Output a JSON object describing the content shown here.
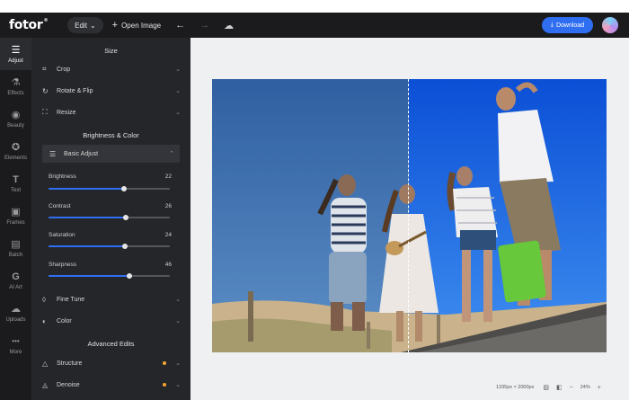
{
  "topbar": {
    "logo": "fotor",
    "logo_mark": "®",
    "edit_label": "Edit",
    "open_image_label": "Open Image",
    "download_label": "Download"
  },
  "rail": {
    "items": [
      {
        "label": "Adjust",
        "icon": "sliders-icon",
        "glyph": "☰"
      },
      {
        "label": "Effects",
        "icon": "flask-icon",
        "glyph": "⚗"
      },
      {
        "label": "Beauty",
        "icon": "eye-icon",
        "glyph": "◉"
      },
      {
        "label": "Elements",
        "icon": "star-icon",
        "glyph": "✪"
      },
      {
        "label": "Text",
        "icon": "text-icon",
        "glyph": "T"
      },
      {
        "label": "Frames",
        "icon": "frame-icon",
        "glyph": "▣"
      },
      {
        "label": "Batch",
        "icon": "image-stack-icon",
        "glyph": "▤"
      },
      {
        "label": "AI Art",
        "icon": "ai-art-icon",
        "glyph": "G"
      },
      {
        "label": "Uploads",
        "icon": "cloud-upload-icon",
        "glyph": "☁"
      },
      {
        "label": "More",
        "icon": "more-icon",
        "glyph": "•••"
      }
    ]
  },
  "panel": {
    "size_title": "Size",
    "crop_label": "Crop",
    "rotate_label": "Rotate & Flip",
    "resize_label": "Resize",
    "brightness_title": "Brightness & Color",
    "basic_adjust_label": "Basic Adjust",
    "sliders": [
      {
        "label": "Brightness",
        "value": 22,
        "fraction": 0.62
      },
      {
        "label": "Contrast",
        "value": 26,
        "fraction": 0.64
      },
      {
        "label": "Saturation",
        "value": 24,
        "fraction": 0.63
      },
      {
        "label": "Sharpness",
        "value": 46,
        "fraction": 0.67
      }
    ],
    "fine_tune_label": "Fine Tune",
    "color_label": "Color",
    "advanced_title": "Advanced Edits",
    "structure_label": "Structure",
    "denoise_label": "Denoise"
  },
  "bottombar": {
    "image_size": "1335px × 2000px",
    "zoom": "24%",
    "minus": "−",
    "plus": "+"
  }
}
